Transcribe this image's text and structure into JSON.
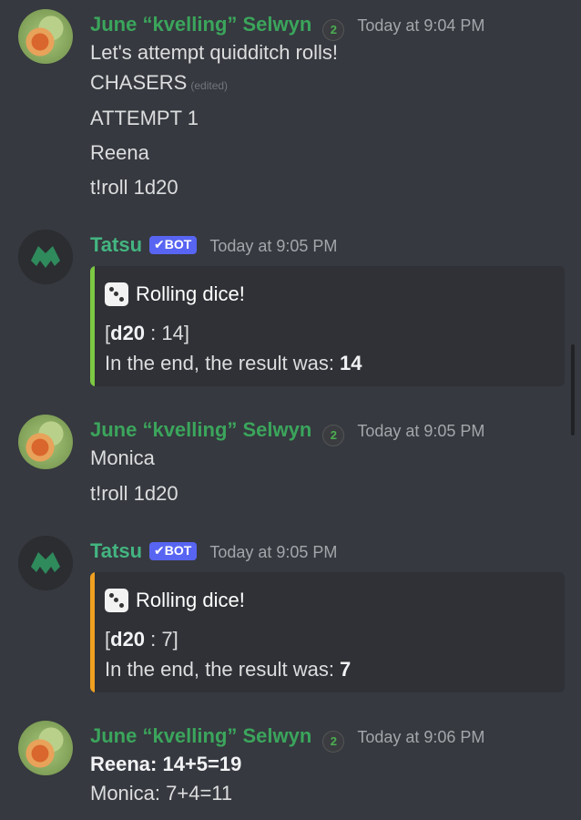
{
  "messages": [
    {
      "author": "June “kvelling” Selwyn",
      "timestamp": "Today at 9:04 PM",
      "lines": [
        "Let's attempt quidditch rolls!",
        "CHASERS",
        "ATTEMPT 1",
        "Reena",
        "t!roll 1d20"
      ],
      "edited_label": "(edited)"
    },
    {
      "author": "Tatsu",
      "bot_label": "✔BOT",
      "timestamp": "Today at 9:05 PM",
      "embed": {
        "accent_color": "#7cc943",
        "title": "Rolling dice!",
        "roll_prefix": "[",
        "roll_die": "d20",
        "roll_sep": " : ",
        "roll_value": "14",
        "roll_suffix": "]",
        "result_prefix": "In the end, the result was: ",
        "result_value": "14"
      }
    },
    {
      "author": "June “kvelling” Selwyn",
      "timestamp": "Today at 9:05 PM",
      "lines": [
        "Monica",
        "t!roll 1d20"
      ]
    },
    {
      "author": "Tatsu",
      "bot_label": "✔BOT",
      "timestamp": "Today at 9:05 PM",
      "embed": {
        "accent_color": "#f0a020",
        "title": "Rolling dice!",
        "roll_prefix": "[",
        "roll_die": "d20",
        "roll_sep": " : ",
        "roll_value": "7",
        "roll_suffix": "]",
        "result_prefix": "In the end, the result was: ",
        "result_value": "7"
      }
    },
    {
      "author": "June “kvelling” Selwyn",
      "timestamp": "Today at 9:06 PM",
      "lines": [
        "Reena: 14+5=19",
        "Monica: 7+4=11"
      ]
    }
  ],
  "icons": {
    "role_icon": "slytherin-badge-icon",
    "die_icon": "die-icon",
    "bot_check_icon": "checkmark-icon"
  }
}
